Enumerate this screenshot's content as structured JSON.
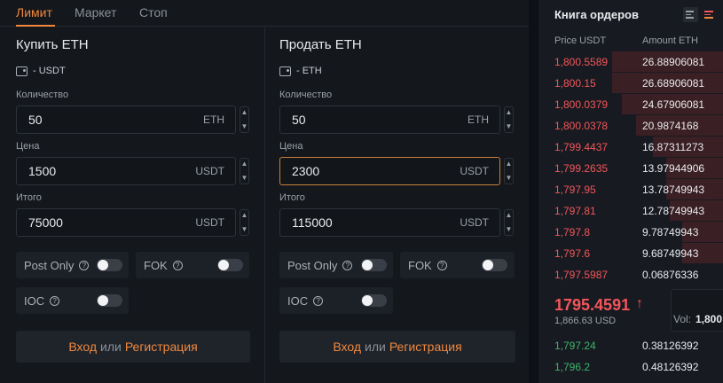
{
  "tabs": [
    "Лимит",
    "Маркет",
    "Стоп"
  ],
  "buy": {
    "title": "Купить ETH",
    "balance": "- USDT",
    "qty_label": "Количество",
    "qty_value": "50",
    "qty_unit": "ETH",
    "price_label": "Цена",
    "price_value": "1500",
    "price_unit": "USDT",
    "total_label": "Итого",
    "total_value": "75000",
    "total_unit": "USDT"
  },
  "sell": {
    "title": "Продать ETH",
    "balance": "- ETH",
    "qty_label": "Количество",
    "qty_value": "50",
    "qty_unit": "ETH",
    "price_label": "Цена",
    "price_value": "2300",
    "price_unit": "USDT",
    "total_label": "Итого",
    "total_value": "115000",
    "total_unit": "USDT"
  },
  "options": {
    "post_only": "Post Only",
    "fok": "FOK",
    "ioc": "IOC",
    "help": "?"
  },
  "login": {
    "login": "Вход",
    "or": "или",
    "register": "Регистрация"
  },
  "orderbook": {
    "title": "Книга ордеров",
    "col_price": "Price USDT",
    "col_amount": "Amount ETH",
    "asks": [
      {
        "price": "1,800.5589",
        "amount": "26.88906081",
        "depth": 0.6
      },
      {
        "price": "1,800.15",
        "amount": "26.68906081",
        "depth": 0.6
      },
      {
        "price": "1,800.0379",
        "amount": "24.67906081",
        "depth": 0.55
      },
      {
        "price": "1,800.0378",
        "amount": "20.9874168",
        "depth": 0.47
      },
      {
        "price": "1,799.4437",
        "amount": "16.87311273",
        "depth": 0.38
      },
      {
        "price": "1,799.2635",
        "amount": "13.97944906",
        "depth": 0.31
      },
      {
        "price": "1,797.95",
        "amount": "13.78749943",
        "depth": 0.31
      },
      {
        "price": "1,797.81",
        "amount": "12.78749943",
        "depth": 0.29
      },
      {
        "price": "1,797.8",
        "amount": "9.78749943",
        "depth": 0.22
      },
      {
        "price": "1,797.6",
        "amount": "9.68749943",
        "depth": 0.22
      },
      {
        "price": "1,797.5987",
        "amount": "0.06876336",
        "depth": 0.0
      }
    ],
    "last_price": "1795.4591",
    "last_arrow": "↑",
    "last_usd": "1,866.63 USD",
    "vol_top": "Vo",
    "vol_label": "Vol:",
    "vol_value": "1,800",
    "bids": [
      {
        "price": "1,797.24",
        "amount": "0.38126392"
      },
      {
        "price": "1,796.2",
        "amount": "0.48126392"
      }
    ]
  },
  "colors": {
    "accent": "#f0883e",
    "ask": "#f2555a",
    "bid": "#3fb36a"
  }
}
